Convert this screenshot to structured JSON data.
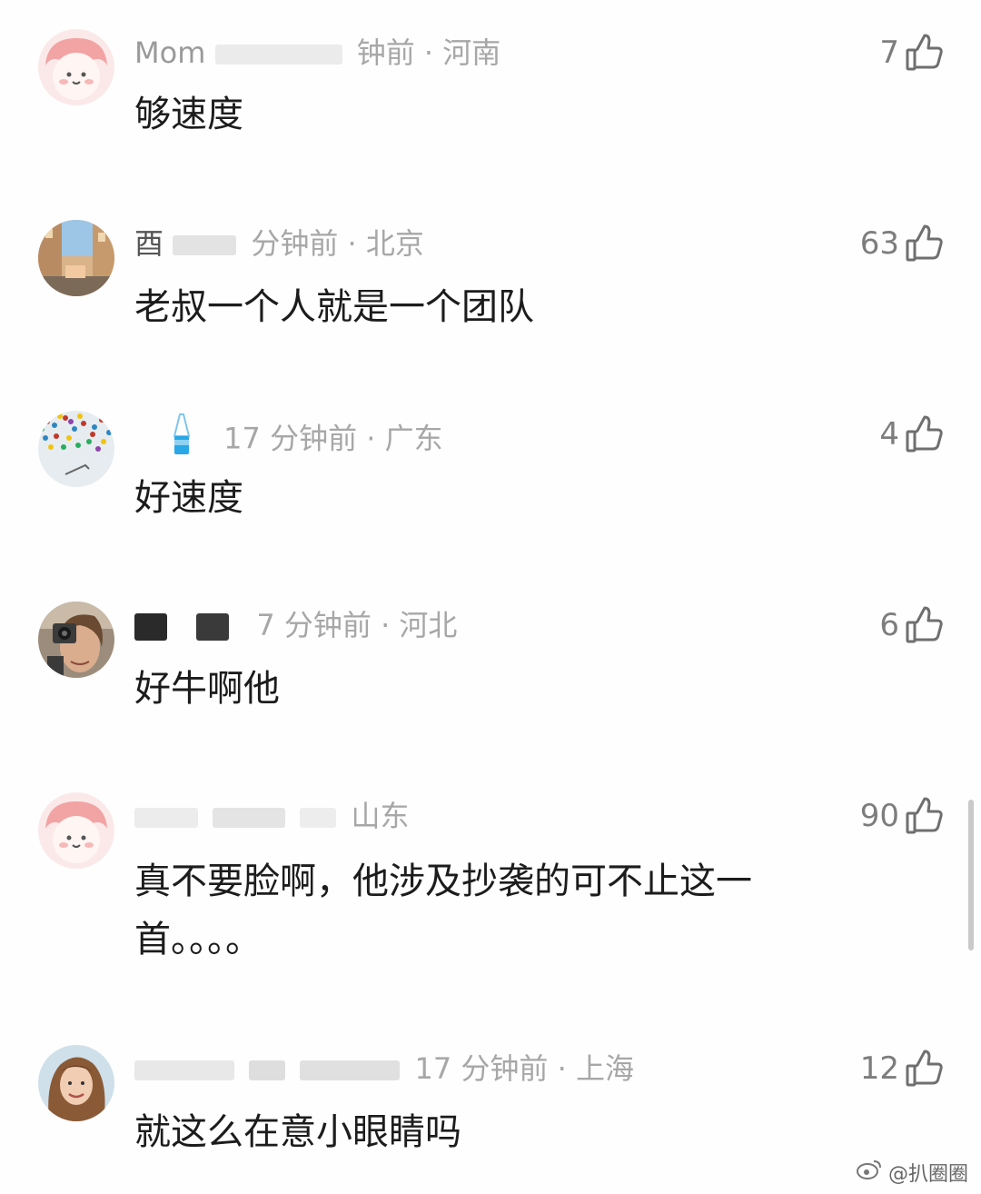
{
  "comments": [
    {
      "username": "Mom",
      "time": "钟前",
      "location": "河南",
      "text": "够速度",
      "likes": "7"
    },
    {
      "username": "酉",
      "time": "分钟前",
      "location": "北京",
      "text": "老叔一个人就是一个团队",
      "likes": "63"
    },
    {
      "username": "",
      "time": "17 分钟前",
      "location": "广东",
      "text": "好速度",
      "likes": "4"
    },
    {
      "username": "",
      "time": "7 分钟前",
      "location": "河北",
      "text": "好牛啊他",
      "likes": "6"
    },
    {
      "username": "",
      "time": "",
      "location": "山东",
      "text": "真不要脸啊，他涉及抄袭的可不止这一首。。。。",
      "likes": "90"
    },
    {
      "username": "",
      "time": "17 分钟前",
      "location": "上海",
      "text": "就这么在意小眼睛吗",
      "likes": "12"
    }
  ],
  "watermark": {
    "text": "@扒圈圈",
    "icon": "weibo-icon"
  },
  "colors": {
    "meta": "#a7a7a7",
    "text": "#1c1c1c",
    "like": "#7d7d7d"
  }
}
